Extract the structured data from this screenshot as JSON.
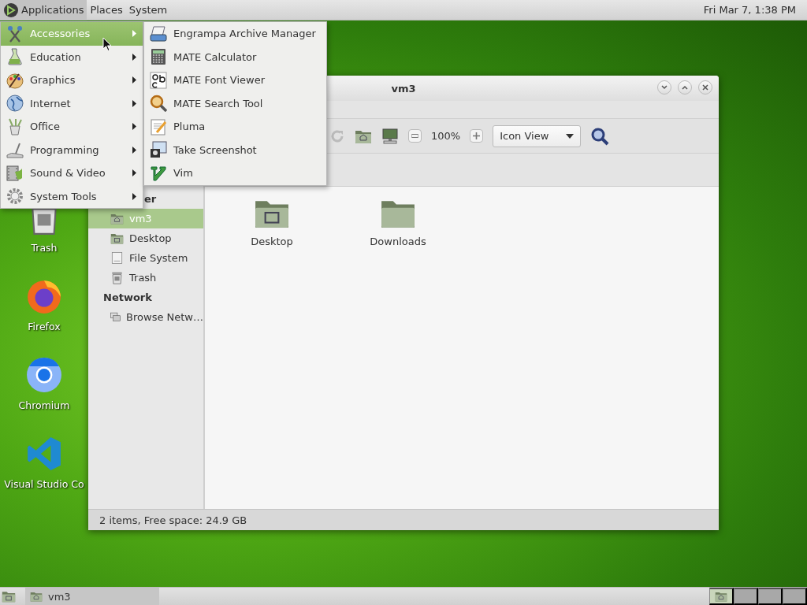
{
  "top_panel": {
    "menus": [
      {
        "label": "Applications",
        "selected": true
      },
      {
        "label": "Places",
        "selected": false
      },
      {
        "label": "System",
        "selected": false
      }
    ],
    "clock": "Fri Mar 7, 1:38 PM"
  },
  "desktop_icons": [
    {
      "label": "Trash",
      "kind": "trash"
    },
    {
      "label": "Firefox",
      "kind": "firefox"
    },
    {
      "label": "Chromium",
      "kind": "chromium"
    },
    {
      "label": "Visual Studio Co",
      "kind": "vscode"
    }
  ],
  "window": {
    "title": "vm3",
    "toolbar": {
      "zoom": "100%",
      "view": "Icon View"
    },
    "sidebar": [
      {
        "heading": "er",
        "items": [
          {
            "label": "vm3",
            "kind": "home",
            "selected": true
          },
          {
            "label": "Desktop",
            "kind": "desktop",
            "selected": false
          },
          {
            "label": "File System",
            "kind": "drive",
            "selected": false
          },
          {
            "label": "Trash",
            "kind": "trash",
            "selected": false
          }
        ]
      },
      {
        "heading": "Network",
        "items": [
          {
            "label": "Browse Netw…",
            "kind": "network",
            "selected": false
          }
        ]
      }
    ],
    "files": [
      {
        "label": "Desktop",
        "kind": "desktop"
      },
      {
        "label": "Downloads",
        "kind": "folder"
      }
    ],
    "status_bar": "2 items, Free space: 24.9 GB"
  },
  "applications_menu": {
    "items": [
      {
        "label": "Accessories",
        "kind": "accessories",
        "selected": true
      },
      {
        "label": "Education",
        "kind": "education",
        "selected": false
      },
      {
        "label": "Graphics",
        "kind": "graphics",
        "selected": false
      },
      {
        "label": "Internet",
        "kind": "internet",
        "selected": false
      },
      {
        "label": "Office",
        "kind": "office",
        "selected": false
      },
      {
        "label": "Programming",
        "kind": "programming",
        "selected": false
      },
      {
        "label": "Sound & Video",
        "kind": "sound_video",
        "selected": false
      },
      {
        "label": "System Tools",
        "kind": "system_tools",
        "selected": false
      }
    ]
  },
  "submenu": {
    "items": [
      {
        "label": "Engrampa Archive Manager",
        "kind": "archive"
      },
      {
        "label": "MATE Calculator",
        "kind": "calculator"
      },
      {
        "label": "MATE Font Viewer",
        "kind": "font"
      },
      {
        "label": "MATE Search Tool",
        "kind": "search"
      },
      {
        "label": "Pluma",
        "kind": "editor"
      },
      {
        "label": "Take Screenshot",
        "kind": "screenshot"
      },
      {
        "label": "Vim",
        "kind": "vim"
      }
    ]
  },
  "taskbar": {
    "tasks": [
      {
        "label": "vm3"
      }
    ],
    "workspaces": [
      {
        "selected": true
      },
      {
        "selected": false
      },
      {
        "selected": false
      },
      {
        "selected": false
      }
    ]
  }
}
